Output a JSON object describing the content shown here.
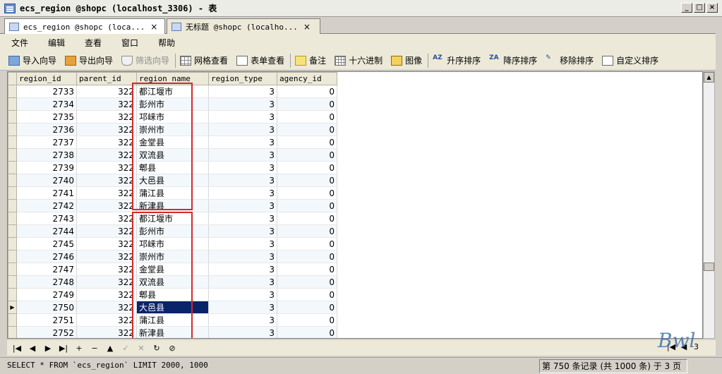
{
  "window": {
    "title": "ecs_region @shopc (localhost_3306) - 表",
    "min_glyph": "_",
    "max_glyph": "□",
    "close_glyph": "×"
  },
  "tabs": [
    {
      "label": "ecs_region @shopc (loca...",
      "close": "×",
      "active": true
    },
    {
      "label": "无标题 @shopc (localho...",
      "close": "×",
      "active": false
    }
  ],
  "menu": [
    "文件",
    "编辑",
    "查看",
    "窗口",
    "帮助"
  ],
  "toolbar": {
    "import": "导入向导",
    "export": "导出向导",
    "filter": "筛选向导",
    "grid_view": "网格查看",
    "form_view": "表单查看",
    "memo": "备注",
    "hex": "十六进制",
    "image": "图像",
    "sort_asc": "升序排序",
    "sort_desc": "降序排序",
    "remove_sort": "移除排序",
    "custom_sort": "自定义排序",
    "sort_asc_icon_text": "AZ",
    "sort_desc_icon_text": "ZA"
  },
  "columns": [
    "region_id",
    "parent_id",
    "region_name",
    "region_type",
    "agency_id"
  ],
  "rows": [
    {
      "region_id": "2733",
      "parent_id": "322",
      "region_name": "都江堰市",
      "region_type": "3",
      "agency_id": "0"
    },
    {
      "region_id": "2734",
      "parent_id": "322",
      "region_name": "彭州市",
      "region_type": "3",
      "agency_id": "0"
    },
    {
      "region_id": "2735",
      "parent_id": "322",
      "region_name": "邛崃市",
      "region_type": "3",
      "agency_id": "0"
    },
    {
      "region_id": "2736",
      "parent_id": "322",
      "region_name": "崇州市",
      "region_type": "3",
      "agency_id": "0"
    },
    {
      "region_id": "2737",
      "parent_id": "322",
      "region_name": "金堂县",
      "region_type": "3",
      "agency_id": "0"
    },
    {
      "region_id": "2738",
      "parent_id": "322",
      "region_name": "双流县",
      "region_type": "3",
      "agency_id": "0"
    },
    {
      "region_id": "2739",
      "parent_id": "322",
      "region_name": "郫县",
      "region_type": "3",
      "agency_id": "0"
    },
    {
      "region_id": "2740",
      "parent_id": "322",
      "region_name": "大邑县",
      "region_type": "3",
      "agency_id": "0"
    },
    {
      "region_id": "2741",
      "parent_id": "322",
      "region_name": "蒲江县",
      "region_type": "3",
      "agency_id": "0"
    },
    {
      "region_id": "2742",
      "parent_id": "322",
      "region_name": "新津县",
      "region_type": "3",
      "agency_id": "0"
    },
    {
      "region_id": "2743",
      "parent_id": "322",
      "region_name": "都江堰市",
      "region_type": "3",
      "agency_id": "0"
    },
    {
      "region_id": "2744",
      "parent_id": "322",
      "region_name": "彭州市",
      "region_type": "3",
      "agency_id": "0"
    },
    {
      "region_id": "2745",
      "parent_id": "322",
      "region_name": "邛崃市",
      "region_type": "3",
      "agency_id": "0"
    },
    {
      "region_id": "2746",
      "parent_id": "322",
      "region_name": "崇州市",
      "region_type": "3",
      "agency_id": "0"
    },
    {
      "region_id": "2747",
      "parent_id": "322",
      "region_name": "金堂县",
      "region_type": "3",
      "agency_id": "0"
    },
    {
      "region_id": "2748",
      "parent_id": "322",
      "region_name": "双流县",
      "region_type": "3",
      "agency_id": "0"
    },
    {
      "region_id": "2749",
      "parent_id": "322",
      "region_name": "郫县",
      "region_type": "3",
      "agency_id": "0"
    },
    {
      "region_id": "2750",
      "parent_id": "322",
      "region_name": "大邑县",
      "region_type": "3",
      "agency_id": "0"
    },
    {
      "region_id": "2751",
      "parent_id": "322",
      "region_name": "蒲江县",
      "region_type": "3",
      "agency_id": "0"
    },
    {
      "region_id": "2752",
      "parent_id": "322",
      "region_name": "新津县",
      "region_type": "3",
      "agency_id": "0"
    }
  ],
  "selected_row": 17,
  "nav_buttons": [
    "|◀",
    "◀",
    "▶",
    "▶|",
    "+",
    "−",
    "▲",
    "✓",
    "✕",
    "↻",
    "⊘"
  ],
  "page": {
    "value": "3"
  },
  "status": {
    "sql": "SELECT * FROM `ecs_region` LIMIT 2000, 1000",
    "count": "第 750 条记录 (共 1000 条) 于 3 页"
  },
  "colors": {
    "highlight_box": "#d6282a",
    "selection": "#0a246a"
  },
  "watermark": "Bwl"
}
